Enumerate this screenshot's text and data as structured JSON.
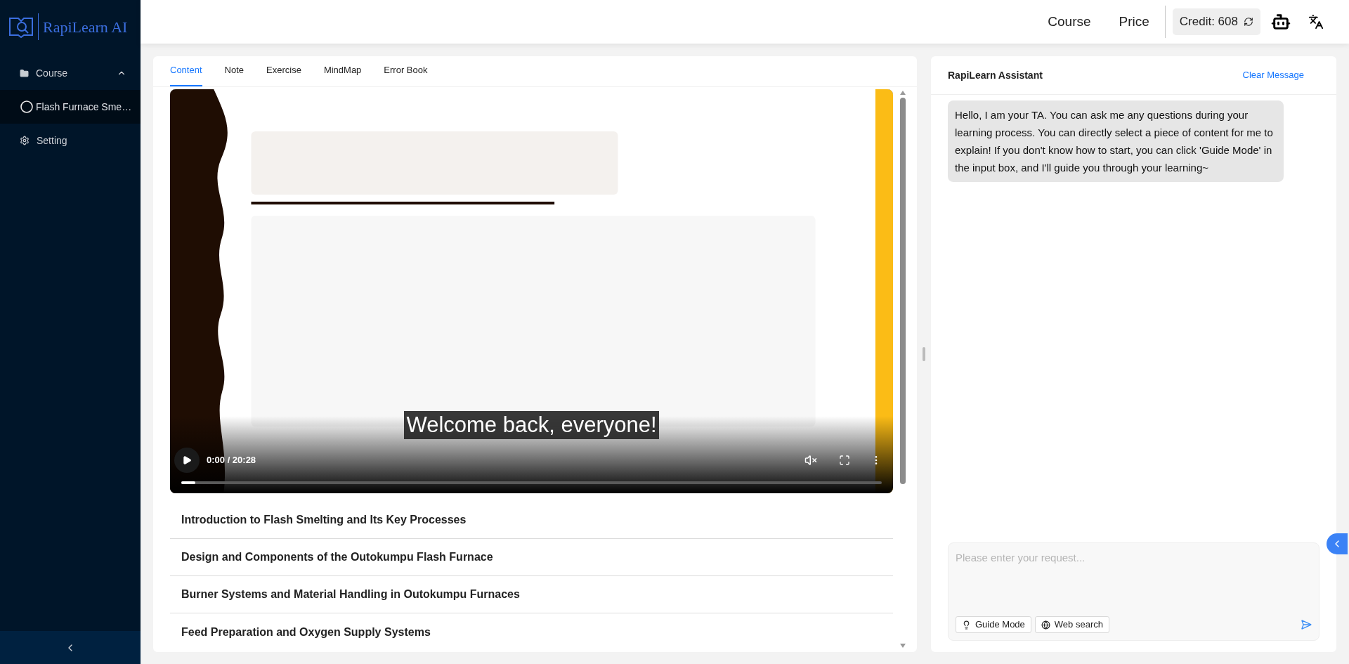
{
  "sidebar": {
    "logo": "RapiLearn AI",
    "course_menu": {
      "label": "Course",
      "expanded": true
    },
    "course_items": [
      {
        "label": "Flash Furnace Sme…",
        "selected": true
      }
    ],
    "setting": "Setting"
  },
  "header": {
    "nav": [
      "Course",
      "Price"
    ],
    "credit": "Credit: 608"
  },
  "tabs": [
    {
      "label": "Content",
      "selected": true
    },
    {
      "label": "Note",
      "selected": false
    },
    {
      "label": "Exercise",
      "selected": false
    },
    {
      "label": "MindMap",
      "selected": false
    },
    {
      "label": "Error Book",
      "selected": false
    }
  ],
  "video": {
    "kind": "picture",
    "subtitle": "Welcome back, everyone!",
    "time": "0:00 / 20:28",
    "level": 0.02,
    "muted": true
  },
  "chapters": [
    "Introduction to Flash Smelting and Its Key Processes",
    "Design and Components of the Outokumpu Flash Furnace",
    "Burner Systems and Material Handling in Outokumpu Furnaces",
    "Feed Preparation and Oxygen Supply Systems"
  ],
  "assistant": {
    "title": "RapiLearn Assistant",
    "clear": "Clear Message",
    "message": "Hello, I am your TA. You can ask me any questions during your learning process. You can directly select a piece of content for me to explain! If you don't know how to start, you can click 'Guide Mode' in the input box, and I'll guide you through your learning~",
    "placeholder": "Please enter your request...",
    "tools": [
      {
        "kind": "guide",
        "label": "Guide Mode"
      },
      {
        "kind": "web",
        "label": "Web search"
      }
    ]
  }
}
